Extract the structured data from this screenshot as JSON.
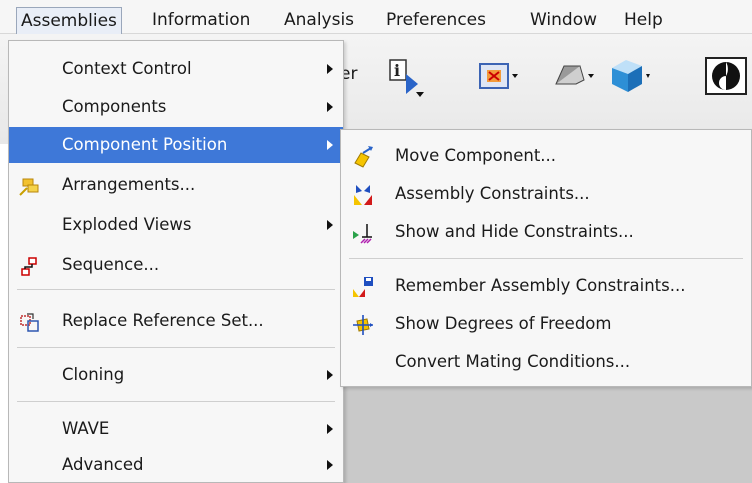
{
  "menubar": {
    "items": [
      {
        "label": "Assemblies"
      },
      {
        "label": "Information"
      },
      {
        "label": "Analysis"
      },
      {
        "label": "Preferences"
      },
      {
        "label": "Window"
      },
      {
        "label": "Help"
      }
    ],
    "partial_toolbar_label": "er"
  },
  "assemblies_menu": {
    "items": [
      {
        "label": "Context Control",
        "icon": "none",
        "submenu": true
      },
      {
        "label": "Components",
        "icon": "none",
        "submenu": true
      },
      {
        "label": "Component Position",
        "icon": "none",
        "submenu": true,
        "highlighted": true
      },
      {
        "label": "Arrangements...",
        "icon": "arrangements-icon",
        "submenu": false
      },
      {
        "label": "Exploded Views",
        "icon": "none",
        "submenu": true
      },
      {
        "label": "Sequence...",
        "icon": "sequence-icon",
        "submenu": false
      },
      {
        "label": "Replace Reference Set...",
        "icon": "replace-reference-set-icon",
        "submenu": false
      },
      {
        "label": "Cloning",
        "icon": "none",
        "submenu": true
      },
      {
        "label": "WAVE",
        "icon": "none",
        "submenu": true
      },
      {
        "label": "Advanced",
        "icon": "none",
        "submenu": true
      }
    ]
  },
  "component_position_submenu": {
    "items": [
      {
        "label": "Move Component...",
        "icon": "move-component-icon"
      },
      {
        "label": "Assembly Constraints...",
        "icon": "assembly-constraints-icon"
      },
      {
        "label": "Show and Hide Constraints...",
        "icon": "show-hide-constraints-icon"
      },
      {
        "label": "Remember Assembly Constraints...",
        "icon": "remember-constraints-icon"
      },
      {
        "label": "Show Degrees of Freedom",
        "icon": "degrees-of-freedom-icon"
      },
      {
        "label": "Convert Mating Conditions...",
        "icon": "none"
      }
    ]
  },
  "colors": {
    "highlight": "#3e78d8",
    "menu_bg": "#f7f7f7"
  }
}
